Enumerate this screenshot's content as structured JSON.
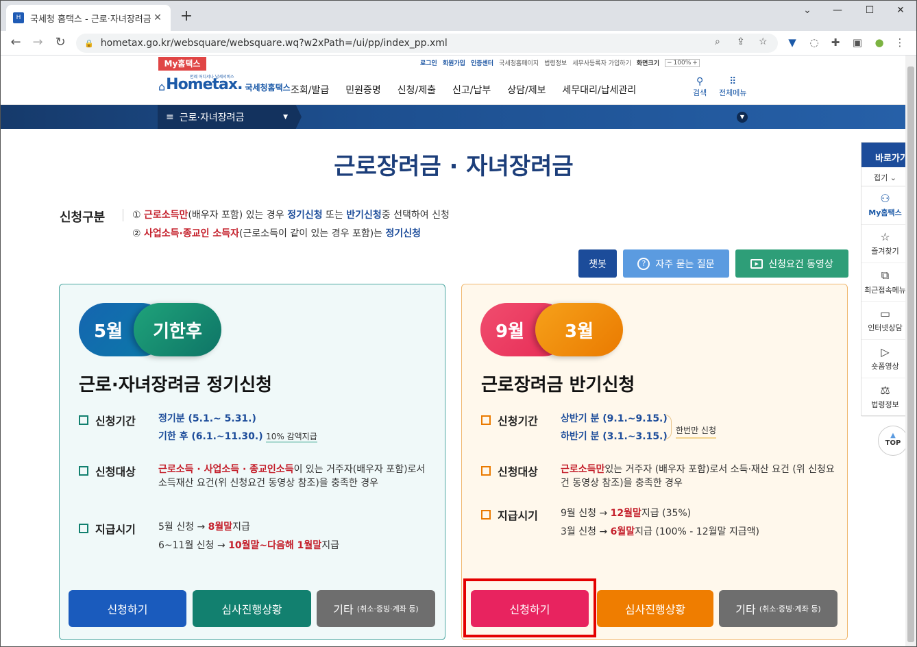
{
  "browser": {
    "tab_title": "국세청 홈택스 - 근로·자녀장려금",
    "url": "hometax.go.kr/websquare/websquare.wq?w2xPath=/ui/pp/index_pp.xml"
  },
  "util": {
    "my_hometax": "My홈택스",
    "login": "로그인",
    "signup": "회원가입",
    "auth_center": "인증센터",
    "nts_home": "국세청홈페이지",
    "law_info": "법령정보",
    "tax_agent_signup": "세무사등록자 가입하기",
    "screen_size": "화면크기",
    "zoom": "100%"
  },
  "header": {
    "logo_main": "Hometax.",
    "logo_sub": "국세청홈택스",
    "logo_tiny": "언제 어디서나 납세서비스",
    "gnb": [
      "조회/발급",
      "민원증명",
      "신청/제출",
      "신고/납부",
      "상담/제보",
      "세무대리/납세관리"
    ],
    "search": "검색",
    "all_menu": "전체메뉴"
  },
  "crumb": "근로·자녀장려금",
  "page_title": "근로장려금 · 자녀장려금",
  "appl_type": {
    "label": "신청구분",
    "rule1": {
      "num": "①",
      "r": "근로소득만",
      "t1": "(배우자 포함) 있는 경우 ",
      "b1": "정기신청",
      "t2": " 또는 ",
      "b2": "반기신청",
      "t3": "중 선택하여 신청"
    },
    "rule2": {
      "num": "②",
      "r": "사업소득·종교인 소득자",
      "t1": "(근로소득이 같이 있는 경우 포함)는 ",
      "b1": "정기신청"
    }
  },
  "buttons_top": {
    "chatbot": "챗봇",
    "faq": "자주 묻는 질문",
    "video": "신청요건 동영상"
  },
  "left_card": {
    "pill_a": "5월",
    "pill_b": "기한후",
    "title": "근로·자녀장려금 정기신청",
    "period_label": "신청기간",
    "period1": "정기분 (5.1.~ 5.31.)",
    "period2": "기한 후 (6.1.~11.30.)",
    "period2_note": "10% 감액지급",
    "target_label": "신청대상",
    "target_red": "근로소득 · 사업소득 · 종교인소득",
    "target_text": "이 있는 거주자(배우자 포함)로서 소득재산 요건(위 신청요건 동영상 참조)을 충족한 경우",
    "pay_label": "지급시기",
    "pay1_a": "5월 신청 → ",
    "pay1_b": "8월말",
    "pay1_c": "지급",
    "pay2_a": "6~11월 신청 → ",
    "pay2_b": "10월말~다음해 1월말",
    "pay2_c": "지급",
    "btn_apply": "신청하기",
    "btn_status": "심사진행상황",
    "btn_etc": "기타",
    "btn_etc_note": "(취소·증빙·계좌 등)"
  },
  "right_card": {
    "pill_a": "9월",
    "pill_b": "3월",
    "title": "근로장려금 반기신청",
    "period_label": "신청기간",
    "period1": "상반기 분 (9.1.~9.15.)",
    "period2": "하반기 분 (3.1.~3.15.)",
    "period_note": "한번만 신청",
    "target_label": "신청대상",
    "target_red": "근로소득만",
    "target_text": "있는 거주자 (배우자 포함)로서 소득·재산 요건 (위 신청요건 동영상 참조)을 충족한 경우",
    "pay_label": "지급시기",
    "pay1_a": "9월 신청 → ",
    "pay1_b": "12월말",
    "pay1_c": "지급 (35%)",
    "pay2_a": "3월 신청 → ",
    "pay2_b": "6월말",
    "pay2_c": "지급 (100% - 12월말 지급액)",
    "btn_apply": "신청하기",
    "btn_status": "심사진행상황",
    "btn_etc": "기타",
    "btn_etc_note": "(취소·증빙·계좌 등)"
  },
  "quick": {
    "header": "바로가기",
    "fold": "접기",
    "items": [
      "My홈택스",
      "즐겨찾기",
      "최근접속메뉴",
      "인터넷상담",
      "숏폼영상",
      "법령정보"
    ],
    "top": "TOP"
  },
  "colors": {
    "accent_blue": "#1c4c9a",
    "teal": "#12806f",
    "pink": "#e8235f",
    "orange": "#ef7d00"
  }
}
